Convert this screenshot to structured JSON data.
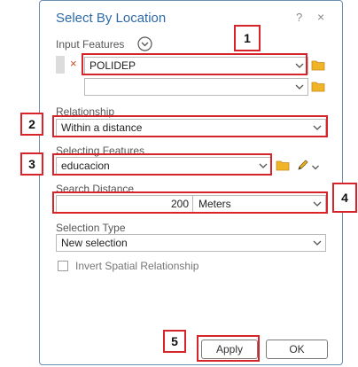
{
  "dialog": {
    "title": "Select By Location",
    "help_glyph": "?",
    "close_glyph": "×"
  },
  "input_features": {
    "label": "Input Features",
    "items": [
      "POLIDEP",
      ""
    ]
  },
  "relationship": {
    "label": "Relationship",
    "value": "Within a distance"
  },
  "selecting_features": {
    "label": "Selecting Features",
    "value": "educacion"
  },
  "search_distance": {
    "label": "Search Distance",
    "value": "200",
    "unit": "Meters"
  },
  "selection_type": {
    "label": "Selection Type",
    "value": "New selection"
  },
  "invert": {
    "label": "Invert Spatial Relationship",
    "checked": false
  },
  "buttons": {
    "apply": "Apply",
    "ok": "OK"
  },
  "annotations": {
    "n1": "1",
    "n2": "2",
    "n3": "3",
    "n4": "4",
    "n5": "5"
  },
  "colors": {
    "accent": "#2f6aa8",
    "highlight": "#d6242a",
    "remove_x": "#d04a2a",
    "folder": "#f0b429"
  },
  "icons": [
    "help-icon",
    "close-icon",
    "expand-circle-icon",
    "remove-x-icon",
    "chevron-down-icon",
    "folder-icon",
    "pencil-icon",
    "checkbox-icon"
  ]
}
